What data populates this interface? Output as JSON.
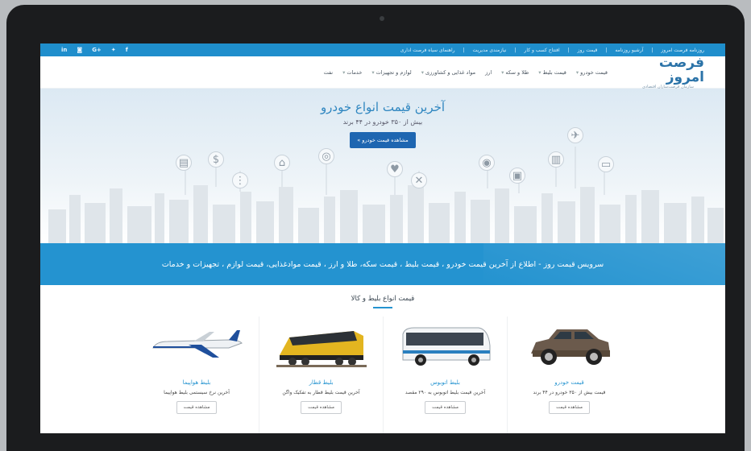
{
  "topbar": {
    "links": [
      "روزنامه فرصت امروز",
      "آرشیو روزنامه",
      "قیمت روز",
      "افتتاح کسب و کار",
      "نیازمندی مدیریت",
      "راهنمای سیاه فرصت اداری"
    ],
    "social": [
      {
        "icon": "linkedin-icon",
        "glyph": "in"
      },
      {
        "icon": "instagram-icon",
        "glyph": "◙"
      },
      {
        "icon": "google-plus-icon",
        "glyph": "G+"
      },
      {
        "icon": "twitter-icon",
        "glyph": "✦"
      },
      {
        "icon": "facebook-icon",
        "glyph": "f"
      }
    ]
  },
  "header": {
    "logo_text": "فرصت امروز",
    "logo_sub": "سازمان فرصت‌سازان اقتصادی",
    "nav": [
      {
        "label": "قیمت خودرو",
        "caret": true
      },
      {
        "label": "قیمت بلیط",
        "caret": true
      },
      {
        "label": "طلا و سکه",
        "caret": true
      },
      {
        "label": "ارز",
        "caret": false
      },
      {
        "label": "مواد غذایی و کشاورزی",
        "caret": true
      },
      {
        "label": "لوازم و تجهیزات",
        "caret": true
      },
      {
        "label": "خدمات",
        "caret": true
      },
      {
        "label": "نفت",
        "caret": false
      }
    ]
  },
  "hero": {
    "title": "آخرین قیمت انواع خودرو",
    "subtitle": "بیش از ۳۵۰ خودرو در ۴۴ برند",
    "button_label": "مشاهده قیمت خودرو »",
    "icons": [
      "bank-icon",
      "dollar-icon",
      "traffic-light-icon",
      "shopping-bag-icon",
      "ring-icon",
      "gift-icon",
      "fish-icon",
      "camera-icon",
      "train-icon",
      "bus-icon",
      "plane-icon",
      "car-icon"
    ]
  },
  "band": {
    "text": "سرویس قیمت روز - اطلاع از آخرین قیمت خودرو ، قیمت بلیط ، قیمت سکه، طلا و ارز ، قیمت موادغذایی، قیمت لوازم ، تجهیزات و خدمات"
  },
  "products": {
    "title": "قیمت انواع بلیط و کالا",
    "cards": [
      {
        "title": "قیمت خودرو",
        "desc": "قیمت بیش از ۳۵۰ خودرو در ۴۴ برند",
        "button": "مشاهده قیمت",
        "image": "car-image"
      },
      {
        "title": "بلیط اتوبوس",
        "desc": "آخرین قیمت بلیط اتوبوس به ۲۹۰ مقصد",
        "button": "مشاهده قیمت",
        "image": "bus-image"
      },
      {
        "title": "بلیط قطار",
        "desc": "آخرین قیمت بلیط قطار به تفکیک واگن",
        "button": "مشاهده قیمت",
        "image": "train-image"
      },
      {
        "title": "بلیط هواپیما",
        "desc": "آخرین نرخ سیستمی بلیط هواپیما",
        "button": "مشاهده قیمت",
        "image": "airplane-image"
      }
    ]
  },
  "colors": {
    "brand_blue": "#2493d0",
    "topbar_blue": "#1f8ecc",
    "button_blue": "#1e66b1",
    "laptop_frame": "#1b1c1e"
  }
}
